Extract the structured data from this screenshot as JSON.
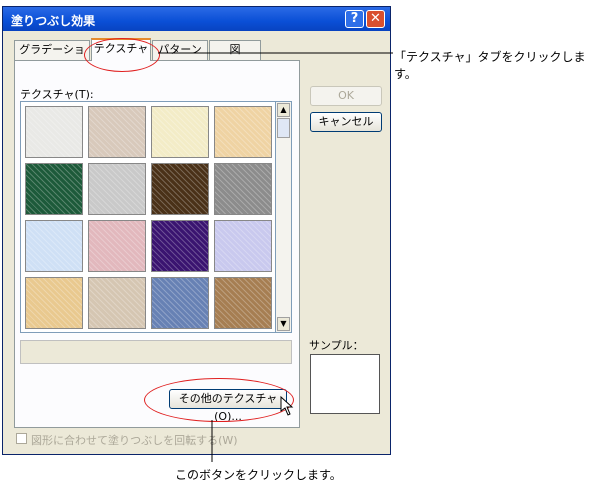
{
  "dialog": {
    "title": "塗りつぶし効果",
    "help_label": "?",
    "close_label": "✕",
    "tabs": [
      {
        "label": "グラデーション"
      },
      {
        "label": "テクスチャ"
      },
      {
        "label": "パターン"
      },
      {
        "label": "図"
      }
    ],
    "active_tab": "テクスチャ",
    "texture_label": "テクスチャ(T):",
    "textures": [
      {
        "name": "paper-white",
        "color": "#e9e9e6"
      },
      {
        "name": "canvas-beige",
        "color": "#d8c9bb"
      },
      {
        "name": "papyrus-cream",
        "color": "#f3ecc7"
      },
      {
        "name": "parchment-tan",
        "color": "#efd3a3"
      },
      {
        "name": "green-marble",
        "color": "#1d5a3a"
      },
      {
        "name": "white-marble",
        "color": "#c9c9c9"
      },
      {
        "name": "brown-marble",
        "color": "#4a3118"
      },
      {
        "name": "granite-gray",
        "color": "#8c8c8c"
      },
      {
        "name": "blue-tissue",
        "color": "#cfe0f5"
      },
      {
        "name": "pink-tissue",
        "color": "#e2b8bd"
      },
      {
        "name": "purple-mesh",
        "color": "#3a1470"
      },
      {
        "name": "bouquet",
        "color": "#c9c9ee"
      },
      {
        "name": "woven-mat",
        "color": "#e9c98f"
      },
      {
        "name": "burlap-light",
        "color": "#d5c6b2"
      },
      {
        "name": "denim-blue",
        "color": "#6781b4"
      },
      {
        "name": "burlap-dark",
        "color": "#a67e52"
      }
    ],
    "other_textures_button": "その他のテクスチャ(O)...",
    "ok_button": "OK",
    "cancel_button": "キャンセル",
    "sample_label": "サンプル：",
    "rotate_checkbox_label": "図形に合わせて塗りつぶしを回転する(W)"
  },
  "annotations": {
    "tab_instruction": "「テクスチャ」タブをクリックします。",
    "button_instruction": "このボタンをクリックします。",
    "highlight_color": "#e02020"
  }
}
